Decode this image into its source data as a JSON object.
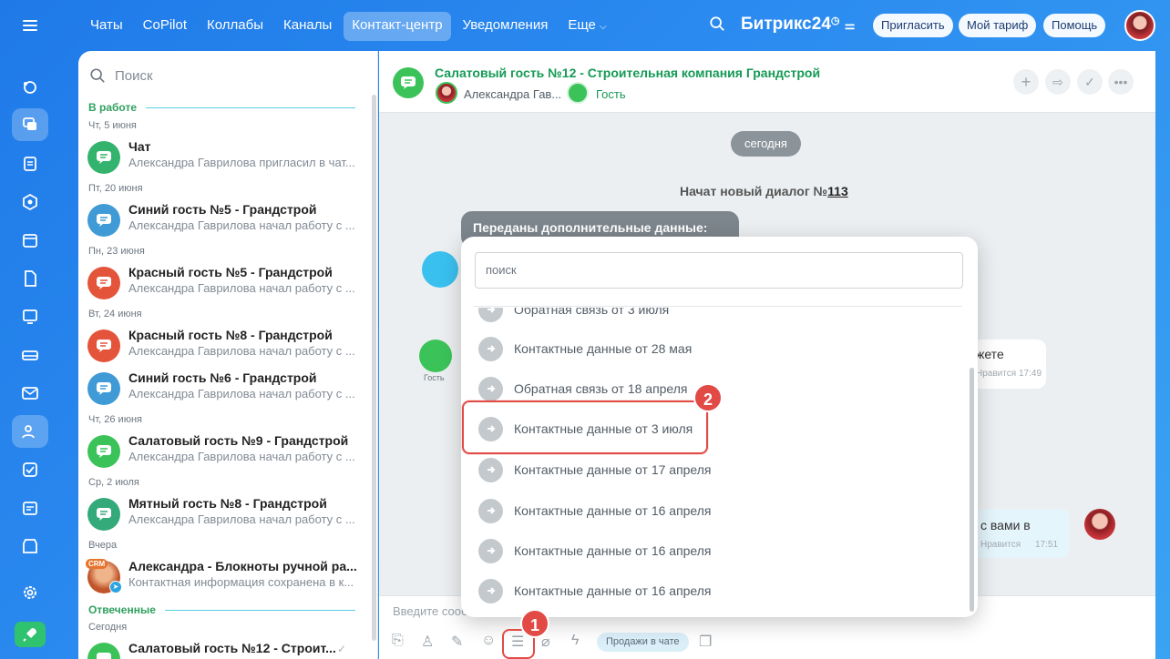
{
  "nav": {
    "tabs": [
      "Чаты",
      "CoPilot",
      "Коллабы",
      "Каналы",
      "Контакт-центр",
      "Уведомления",
      "Еще"
    ],
    "active": "Контакт-центр",
    "more_icon": "chevron-down-icon"
  },
  "header": {
    "brand": "Битрикс24",
    "invite": "Пригласить",
    "plan": "Мой тариф",
    "help": "Помощь"
  },
  "list": {
    "search_placeholder": "Поиск",
    "section_work": "В работе",
    "section_answered": "Отвеченные",
    "dates": [
      "Чт, 5 июня",
      "Пт, 20 июня",
      "Пн, 23 июня",
      "Вт, 24 июня",
      "Чт, 26 июня",
      "Ср, 2 июля",
      "Вчера",
      "Сегодня"
    ],
    "items": [
      {
        "name": "Чат",
        "preview": "Александра Гаврилова пригласил в чат...",
        "color": "#34b36e"
      },
      {
        "name": "Синий гость №5 - Грандстрой",
        "preview": "Александра Гаврилова начал работу с ...",
        "color": "#3f9ad6"
      },
      {
        "name": "Красный гость №5 - Грандстрой",
        "preview": "Александра Гаврилова начал работу с ...",
        "color": "#e4543a"
      },
      {
        "name": "Красный гость №8 - Грандстрой",
        "preview": "Александра Гаврилова начал работу с ...",
        "color": "#e4543a"
      },
      {
        "name": "Синий гость №6 - Грандстрой",
        "preview": "Александра Гаврилова начал работу с ...",
        "color": "#3f9ad6"
      },
      {
        "name": "Салатовый гость №9 - Грандстрой",
        "preview": "Александра Гаврилова начал работу с ...",
        "color": "#3bc35a"
      },
      {
        "name": "Мятный гость №8 - Грандстрой",
        "preview": "Александра Гаврилова начал работу с ...",
        "color": "#34a97a"
      },
      {
        "name": "Александра - Блокноты ручной ра...",
        "preview": "Контактная информация сохранена в к...",
        "color": "#e08a3c"
      },
      {
        "name": "Салатовый гость №12 - Строит...",
        "preview": "",
        "color": "#3bc35a"
      }
    ],
    "crm_badge": "CRM"
  },
  "chat": {
    "title": "Салатовый гость №12 - Строительная компания Грандстрой",
    "operator": "Александра Гав...",
    "guest": "Гость",
    "date_chip": "сегодня",
    "system_prefix": "Начат новый диалог №",
    "dialog_no": "113",
    "dark_bubble": "Переданы дополнительные данные:",
    "guest_label": "Гость",
    "msg1_text": "жете",
    "msg1_like": "Нравится",
    "msg1_time": "17:49",
    "msg2_text": "с вами в",
    "msg2_like": "Нравится",
    "msg2_time": "17:51",
    "composer_placeholder": "Введите сооб",
    "sales_chip": "Продажи в чате"
  },
  "popup": {
    "search_placeholder": "поиск",
    "rows": [
      "Обратная связь от 3 июля",
      "Контактные данные от 28 мая",
      "Обратная связь от 18 апреля",
      "Контактные данные от 3 июля",
      "Контактные данные от 17 апреля",
      "Контактные данные от 16 апреля",
      "Контактные данные от 16 апреля",
      "Контактные данные от 16 апреля"
    ]
  },
  "annotations": {
    "step1": "1",
    "step2": "2",
    "color": "#e14a45"
  }
}
